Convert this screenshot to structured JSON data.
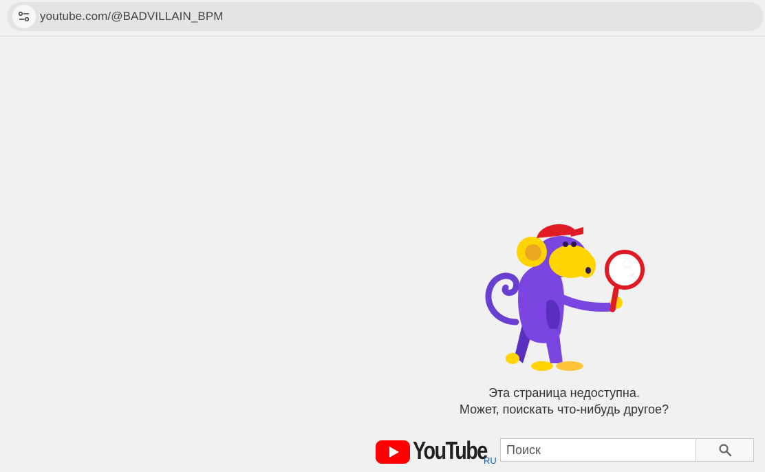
{
  "browser": {
    "url": "youtube.com/@BADVILLAIN_BPM",
    "site_info_icon": "tune-icon"
  },
  "error": {
    "line1": "Эта страница недоступна.",
    "line2": "Может, поискать что-нибудь другое?",
    "illustration": "monkey-with-magnifier"
  },
  "logo": {
    "text": "YouTube",
    "region": "RU",
    "accent": "#ff0000"
  },
  "search": {
    "placeholder": "Поиск",
    "value": "",
    "button_icon": "search-icon"
  }
}
